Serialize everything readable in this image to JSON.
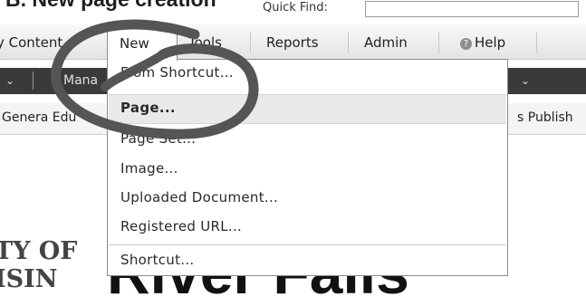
{
  "page": {
    "title": "B. New page creation"
  },
  "topbar": {
    "quick_find_label": "Quick Find:",
    "quick_find_value": ""
  },
  "menubar": {
    "items": [
      {
        "label": "y Content"
      },
      {
        "label": "New"
      },
      {
        "label": "Tools"
      },
      {
        "label": "Reports"
      },
      {
        "label": "Admin"
      },
      {
        "label": "Help",
        "icon": "help-icon"
      }
    ]
  },
  "darkbar": {
    "left_text": "Mana",
    "chevron": "chevron-down-icon"
  },
  "lightbar": {
    "left_text": "Genera Edu",
    "right_text": "s Publish"
  },
  "dropdown": {
    "items": [
      {
        "label": "From Shortcut..."
      },
      {
        "label": "Page...",
        "highlighted": true
      },
      {
        "label": "Page Set..."
      },
      {
        "label": "Image..."
      },
      {
        "label": "Uploaded Document..."
      },
      {
        "label": "Registered URL..."
      },
      {
        "label": "Shortcut..."
      }
    ]
  },
  "banner": {
    "line1": "TY OF",
    "line2": "ISIN",
    "big": "River Falls"
  },
  "annotation": {
    "color": "#555555",
    "icon": "hand-drawn-circle"
  }
}
